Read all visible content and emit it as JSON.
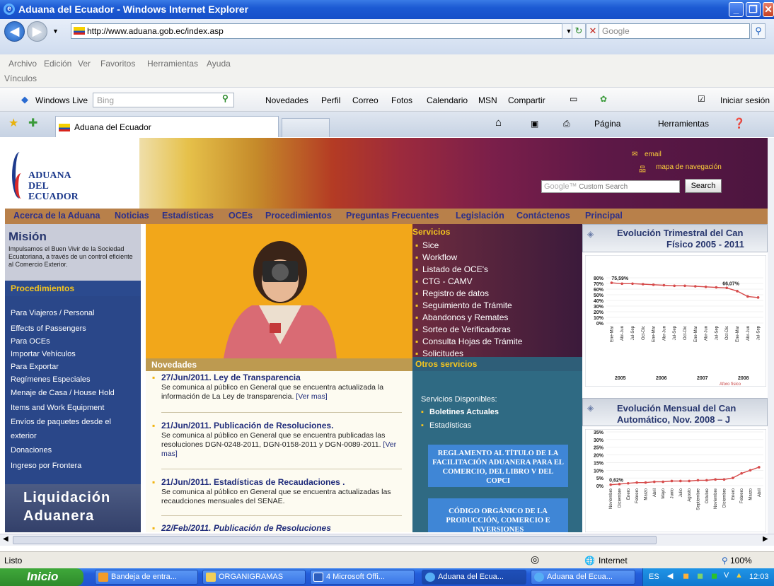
{
  "window": {
    "title": "Aduana del Ecuador - Windows Internet Explorer"
  },
  "address": {
    "url": "http://www.aduana.gob.ec/index.asp",
    "search_placeholder": "Google"
  },
  "menu": {
    "items": [
      "Archivo",
      "Edición",
      "Ver",
      "Favoritos",
      "Herramientas",
      "Ayuda"
    ],
    "links": "Vínculos"
  },
  "livebar": {
    "brand": "Windows Live",
    "search": "Bing",
    "items": [
      "Novedades",
      "Perfil",
      "Correo",
      "Fotos",
      "Calendario",
      "MSN",
      "Compartir"
    ],
    "signin": "Iniciar sesión"
  },
  "tab": {
    "title": "Aduana del Ecuador"
  },
  "ietools": {
    "page": "Página",
    "tools": "Herramientas"
  },
  "site": {
    "logo": [
      "ADUANA",
      "DEL",
      "ECUADOR"
    ],
    "email": "email",
    "sitemap": "mapa de navegación",
    "cse_placeholder": "Custom Search",
    "cse_google": "Google™",
    "search_btn": "Search",
    "nav": [
      "Acerca de la Aduana",
      "Noticias",
      "Estadísticas",
      "OCEs",
      "Procedimientos",
      "Preguntas Frecuentes",
      "Legislación",
      "Contáctenos",
      "Principal"
    ],
    "mision_title": "Misión",
    "mision_text": "Impulsamos el Buen Vivir de la Sociedad Ecuatoriana, a través de un control eficiente al Comercio Exterior.",
    "proc_title": "Procedimientos",
    "proc": [
      "Para Viajeros / Personal",
      "Effects of Passengers",
      "Para OCEs",
      "Importar Vehículos",
      "Para Exportar",
      "Regímenes Especiales",
      "Menaje de Casa / House Hold",
      "Items and Work Equipment",
      "Envíos de paquetes desde el",
      "exterior",
      "Donaciones",
      "Ingreso por Frontera"
    ],
    "liq": [
      "Liquidación",
      "Aduanera"
    ],
    "nov_title": "Novedades",
    "news": [
      {
        "title": "27/Jun/2011. Ley de Transparencia",
        "body": "Se comunica al público en General que se encuentra actualizada la información de La Ley de transparencia.",
        "more": "[Ver mas]"
      },
      {
        "title": "21/Jun/2011. Publicación de Resoluciones.",
        "body": "Se comunica al público en General que se encuentra publicadas las resoluciones DGN-0248-2011, DGN-0158-2011 y DGN-0089-2011.",
        "more": "[Ver mas]"
      },
      {
        "title": "21/Jun/2011. Estadísticas de Recaudaciones .",
        "body": "Se comunica al público en General que se encuentra actualizadas las recaudciones mensuales del SENAE."
      },
      {
        "title": "22/Feb/2011. Publicación de Resoluciones"
      }
    ],
    "serv_title": "Servicios",
    "serv": [
      "Sice",
      "Workflow",
      "Listado de OCE's",
      "CTG - CAMV",
      "Registro de datos",
      "Seguimiento de Trámite",
      "Abandonos y Remates",
      "Sorteo de Verificadoras",
      "Consulta Hojas de Trámite",
      "Solicitudes"
    ],
    "otros_title": "Otros servicios",
    "otros_disp": "Servicios Disponibles:",
    "otros": [
      "Boletines Actuales",
      "Estadísticas"
    ],
    "box1": "REGLAMENTO AL TÍTULO DE LA FACILITACIÓN ADUANERA PARA EL COMERCIO, DEL LIBRO V DEL COPCI",
    "box2": "CÓDIGO ORGÁNICO DE LA PRODUCCIÓN, COMERCIO E INVERSIONES",
    "chart1_title": [
      "Evolución Trimestral del Can",
      "Físico 2005 - 2011"
    ],
    "chart2_title": [
      "Evolución Mensual del Can",
      "Automático, Nov. 2008 – J"
    ]
  },
  "chart_data": [
    {
      "type": "line",
      "title": "Evolución Trimestral del Can Físico 2005 - 2011",
      "yticks": [
        "80%",
        "70%",
        "60%",
        "50%",
        "40%",
        "30%",
        "20%",
        "10%",
        "0%"
      ],
      "years": [
        "2005",
        "2006",
        "2007",
        "2008"
      ],
      "annotations": [
        "75,59%",
        "66,07%"
      ],
      "legend": "Aforo físico",
      "x": [
        "Ene-Mar",
        "Abr-Jun",
        "Jul-Sep",
        "Oct-Dic",
        "Ene-Mar",
        "Abr-Jun",
        "Jul-Sep",
        "Oct-Dic",
        "Ene-Mar",
        "Abr-Jun",
        "Jul-Sep",
        "Oct-Dic",
        "Ene-Mar",
        "Abr-Jun",
        "Jul-Sep"
      ],
      "values": [
        75.59,
        74,
        74,
        73,
        72,
        71,
        70,
        70,
        69,
        68,
        67,
        66.07,
        60,
        50,
        48
      ]
    },
    {
      "type": "line",
      "title": "Evolución Mensual del Can Automático, Nov. 2008 – J",
      "yticks": [
        "35%",
        "30%",
        "25%",
        "20%",
        "15%",
        "10%",
        "5%",
        "0%"
      ],
      "annotations": [
        "0,62%"
      ],
      "x": [
        "Noviembre",
        "Diciembre",
        "Enero",
        "Febrero",
        "Marzo",
        "Abril",
        "Mayo",
        "Junio",
        "Julio",
        "Agosto",
        "Septiembre",
        "Octubre",
        "Noviembre",
        "Diciembre",
        "Enero",
        "Febrero",
        "Marzo",
        "Abril"
      ],
      "values": [
        0.62,
        1,
        1.5,
        2,
        2,
        2.5,
        2.5,
        3,
        3,
        3,
        3.5,
        3.5,
        4,
        4,
        5,
        8,
        10,
        12
      ]
    }
  ],
  "status": {
    "text": "Listo",
    "zone": "Internet",
    "zoom": "100%"
  },
  "taskbar": {
    "start": "Inicio",
    "items": [
      "Bandeja de entra...",
      "ORGANIGRAMAS",
      "4 Microsoft Offi...",
      "Aduana del Ecua...",
      "Aduana del Ecua..."
    ],
    "lang": "ES",
    "clock": "12:03"
  }
}
